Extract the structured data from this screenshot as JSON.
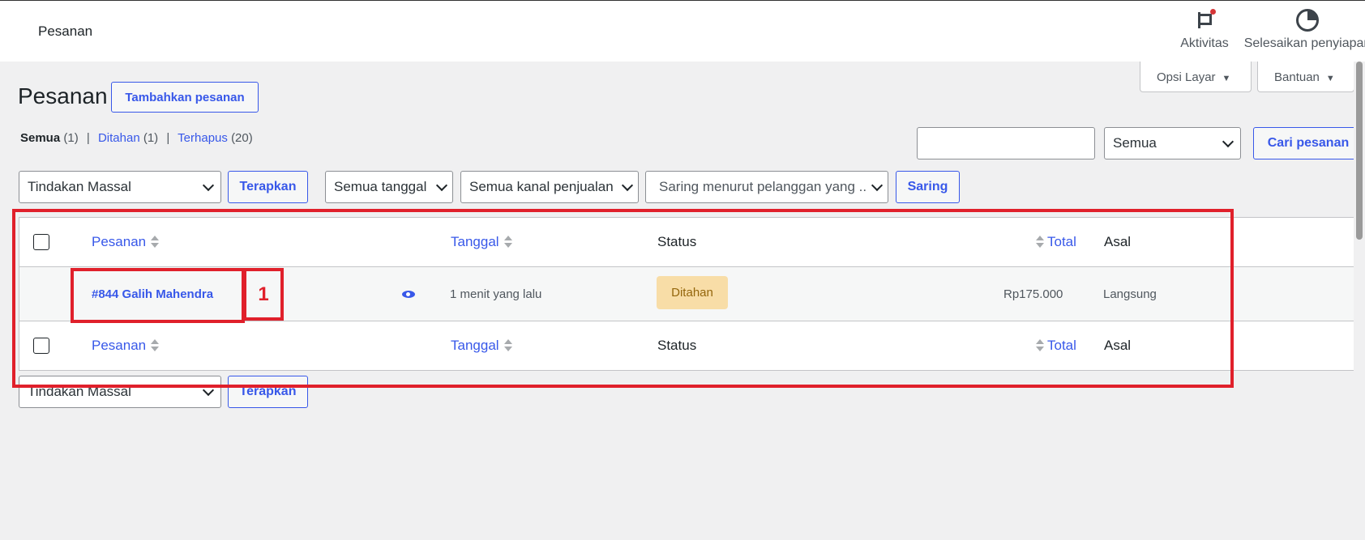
{
  "topbar": {
    "page_name": "Pesanan",
    "activity_label": "Aktivitas",
    "setup_label": "Selesaikan penyiapan"
  },
  "screen_tabs": {
    "screen_options": "Opsi Layar",
    "help": "Bantuan"
  },
  "header": {
    "title": "Pesanan",
    "add_button": "Tambahkan pesanan"
  },
  "views": {
    "all_label": "Semua",
    "all_count": "(1)",
    "hold_label": "Ditahan",
    "hold_count": "(1)",
    "trash_label": "Terhapus",
    "trash_count": "(20)",
    "separator": "|"
  },
  "search": {
    "input_value": "",
    "status_select": "Semua",
    "button": "Cari pesanan"
  },
  "filters": {
    "bulk_action": "Tindakan Massal",
    "apply": "Terapkan",
    "dates": "Semua tanggal",
    "channels": "Semua kanal penjualan",
    "customer": "Saring menurut pelanggan yang ..",
    "filter_button": "Saring"
  },
  "table": {
    "columns": {
      "order": "Pesanan",
      "date": "Tanggal",
      "status": "Status",
      "total": "Total",
      "origin": "Asal"
    },
    "rows": [
      {
        "order": "#844 Galih Mahendra",
        "date": "1 menit yang lalu",
        "status": "Ditahan",
        "total": "Rp175.000",
        "origin": "Langsung"
      }
    ]
  },
  "bottom": {
    "bulk_action": "Tindakan Massal",
    "apply": "Terapkan"
  },
  "annotation": {
    "label": "1",
    "color": "#e0202b"
  },
  "icons": {
    "activity": "flag-icon",
    "setup": "progress-icon",
    "preview": "eye-icon"
  },
  "colors": {
    "accent": "#3858e9",
    "status_hold_bg": "#f8dda7",
    "status_hold_text": "#94660c"
  }
}
